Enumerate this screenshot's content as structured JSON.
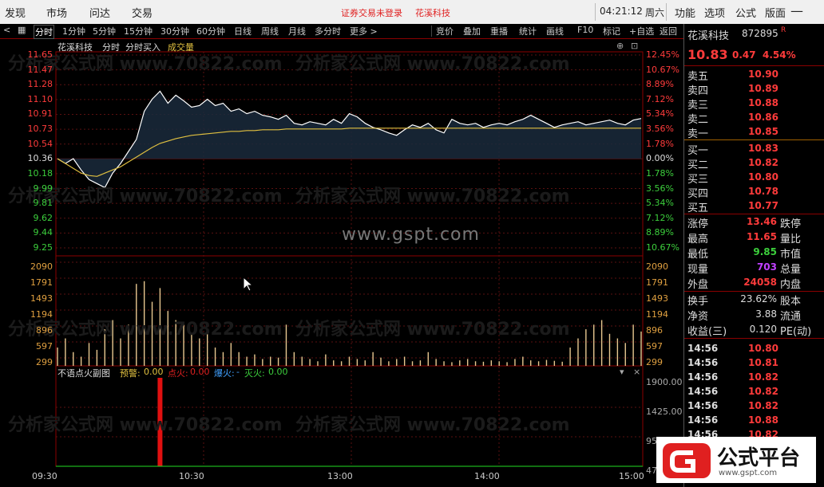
{
  "menu": {
    "items": [
      "发现",
      "市场",
      "问达",
      "交易"
    ]
  },
  "status": {
    "login": "证券交易未登录",
    "stock": "花溪科技"
  },
  "clock": {
    "time": "04:21:12",
    "weekday": "周六"
  },
  "right_menu": [
    "功能",
    "选项",
    "公式",
    "版面"
  ],
  "toolbar": {
    "periods": [
      "分时",
      "1分钟",
      "5分钟",
      "15分钟",
      "30分钟",
      "60分钟",
      "日线",
      "周线",
      "月线",
      "多分时",
      "更多 >"
    ],
    "tools": [
      "竞价",
      "叠加",
      "重播",
      "统计",
      "画线",
      "F10",
      "标记",
      "+自选",
      "返回"
    ]
  },
  "chart_header": {
    "name": "花溪科技",
    "mode": "分时",
    "buy": "分时买入",
    "volume": "成交量"
  },
  "watermark": {
    "site": "www.gspt.com",
    "repeat": "分析家公式网 www.70822.com"
  },
  "indicator": {
    "name": "不语点火副图",
    "warn_label": "预警:",
    "warn_value": "0.00",
    "ignite_label": "点火:",
    "ignite_value": "0.00",
    "explode_label": "爆火:",
    "explode_value": "-",
    "out_label": "灭火:",
    "out_value": "0.00"
  },
  "chart_data": {
    "type": "line",
    "price_axis": {
      "ticks": [
        "11.65",
        "11.47",
        "11.28",
        "11.10",
        "10.91",
        "10.73",
        "10.54",
        "10.36",
        "10.18",
        "9.99",
        "9.81",
        "9.62",
        "9.44",
        "9.25"
      ],
      "pct": [
        "12.45%",
        "10.67%",
        "8.89%",
        "7.12%",
        "5.34%",
        "3.56%",
        "1.78%",
        "0.00%",
        "1.78%",
        "3.56%",
        "5.34%",
        "7.12%",
        "8.89%",
        "10.67%"
      ],
      "ylim": [
        9.25,
        11.65
      ]
    },
    "volume_axis": {
      "ticks": [
        "2090",
        "1791",
        "1493",
        "1194",
        "896",
        "597",
        "299"
      ],
      "ylim": [
        0,
        2090
      ]
    },
    "indicator_axis": {
      "ticks": [
        "1900.00",
        "1425.00",
        "950.00",
        "47"
      ],
      "ylim": [
        0,
        1900
      ]
    },
    "time_labels": [
      "09:30",
      "10:30",
      "13:00",
      "14:00",
      "15:00"
    ],
    "price_series": [
      10.36,
      10.3,
      10.36,
      10.22,
      10.1,
      10.05,
      10.0,
      10.18,
      10.3,
      10.45,
      10.6,
      10.95,
      11.1,
      11.2,
      11.05,
      11.15,
      11.08,
      11.0,
      11.02,
      11.1,
      11.02,
      11.05,
      10.95,
      10.98,
      10.92,
      10.95,
      10.9,
      10.88,
      10.85,
      10.9,
      10.8,
      10.78,
      10.82,
      10.8,
      10.78,
      10.85,
      10.8,
      10.92,
      10.88,
      10.8,
      10.75,
      10.72,
      10.68,
      10.65,
      10.72,
      10.78,
      10.75,
      10.8,
      10.72,
      10.68,
      10.85,
      10.8,
      10.78,
      10.8,
      10.75,
      10.78,
      10.8,
      10.78,
      10.82,
      10.85,
      10.9,
      10.85,
      10.8,
      10.75,
      10.78,
      10.8,
      10.82,
      10.78,
      10.8,
      10.82,
      10.84,
      10.8,
      10.78,
      10.84,
      10.86
    ],
    "avg_series": [
      10.36,
      10.3,
      10.24,
      10.18,
      10.15,
      10.14,
      10.18,
      10.22,
      10.26,
      10.32,
      10.38,
      10.44,
      10.5,
      10.55,
      10.58,
      10.61,
      10.63,
      10.65,
      10.66,
      10.67,
      10.68,
      10.69,
      10.7,
      10.7,
      10.71,
      10.71,
      10.72,
      10.72,
      10.72,
      10.73,
      10.73,
      10.73,
      10.73,
      10.73,
      10.73,
      10.73,
      10.73,
      10.74,
      10.74,
      10.74,
      10.74,
      10.74,
      10.74,
      10.74,
      10.74,
      10.74,
      10.74,
      10.74,
      10.74,
      10.74,
      10.74,
      10.74,
      10.74,
      10.74,
      10.74,
      10.74,
      10.74,
      10.74,
      10.74,
      10.74,
      10.74,
      10.74,
      10.74,
      10.74,
      10.74,
      10.74,
      10.74,
      10.74,
      10.74,
      10.74,
      10.74,
      10.74,
      10.74,
      10.74,
      10.74
    ],
    "volume_series": [
      400,
      600,
      300,
      200,
      500,
      350,
      800,
      1000,
      600,
      900,
      1791,
      1850,
      1400,
      1700,
      1200,
      1000,
      900,
      700,
      600,
      800,
      400,
      300,
      500,
      300,
      200,
      250,
      150,
      200,
      180,
      900,
      300,
      200,
      150,
      100,
      250,
      120,
      100,
      200,
      150,
      120,
      300,
      180,
      100,
      150,
      200,
      100,
      120,
      300,
      150,
      100,
      80,
      120,
      150,
      100,
      90,
      120,
      100,
      80,
      150,
      200,
      120,
      100,
      130,
      110,
      90,
      400,
      600,
      800,
      900,
      1000,
      700,
      600,
      500,
      900,
      750
    ],
    "indicator_bar": {
      "index": 13,
      "value": 1900
    }
  },
  "quote": {
    "name": "花溪科技",
    "code": "872895",
    "flag": "R",
    "price": "10.83",
    "change": "0.47",
    "pct": "4.54%",
    "asks": [
      {
        "label": "卖五",
        "price": "10.90"
      },
      {
        "label": "卖四",
        "price": "10.89"
      },
      {
        "label": "卖三",
        "price": "10.88"
      },
      {
        "label": "卖二",
        "price": "10.86"
      },
      {
        "label": "卖一",
        "price": "10.85"
      }
    ],
    "bids": [
      {
        "label": "买一",
        "price": "10.83"
      },
      {
        "label": "买二",
        "price": "10.82"
      },
      {
        "label": "买三",
        "price": "10.80"
      },
      {
        "label": "买四",
        "price": "10.78"
      },
      {
        "label": "买五",
        "price": "10.77"
      }
    ],
    "stats": [
      {
        "l": "涨停",
        "v": "13.46",
        "r": "跌停"
      },
      {
        "l": "最高",
        "v": "11.65",
        "r": "量比"
      },
      {
        "l": "最低",
        "v": "9.85",
        "r": "市值"
      },
      {
        "l": "现量",
        "v": "703",
        "r": "总量"
      },
      {
        "l": "外盘",
        "v": "24058",
        "r": "内盘"
      }
    ],
    "stats2": [
      {
        "l": "换手",
        "v": "23.62%",
        "r": "股本"
      },
      {
        "l": "净资",
        "v": "3.88",
        "r": "流通"
      },
      {
        "l": "收益(三)",
        "v": "0.120",
        "r": "PE(动)"
      }
    ],
    "ticks": [
      {
        "t": "14:56",
        "p": "10.80"
      },
      {
        "t": "14:56",
        "p": "10.81"
      },
      {
        "t": "14:56",
        "p": "10.82"
      },
      {
        "t": "14:56",
        "p": "10.82"
      },
      {
        "t": "14:56",
        "p": "10.82"
      },
      {
        "t": "14:56",
        "p": "10.88"
      },
      {
        "t": "14:56",
        "p": "10.82"
      }
    ]
  },
  "logo": {
    "text": "公式平台",
    "url": "www.gspt.com"
  },
  "colors": {
    "up": "#ff3b3b",
    "down": "#3ccf3c",
    "price_line": "#ffffff",
    "avg_line": "#e0c040",
    "volume": "#e8c890",
    "indicator_bar": "#e01010"
  }
}
